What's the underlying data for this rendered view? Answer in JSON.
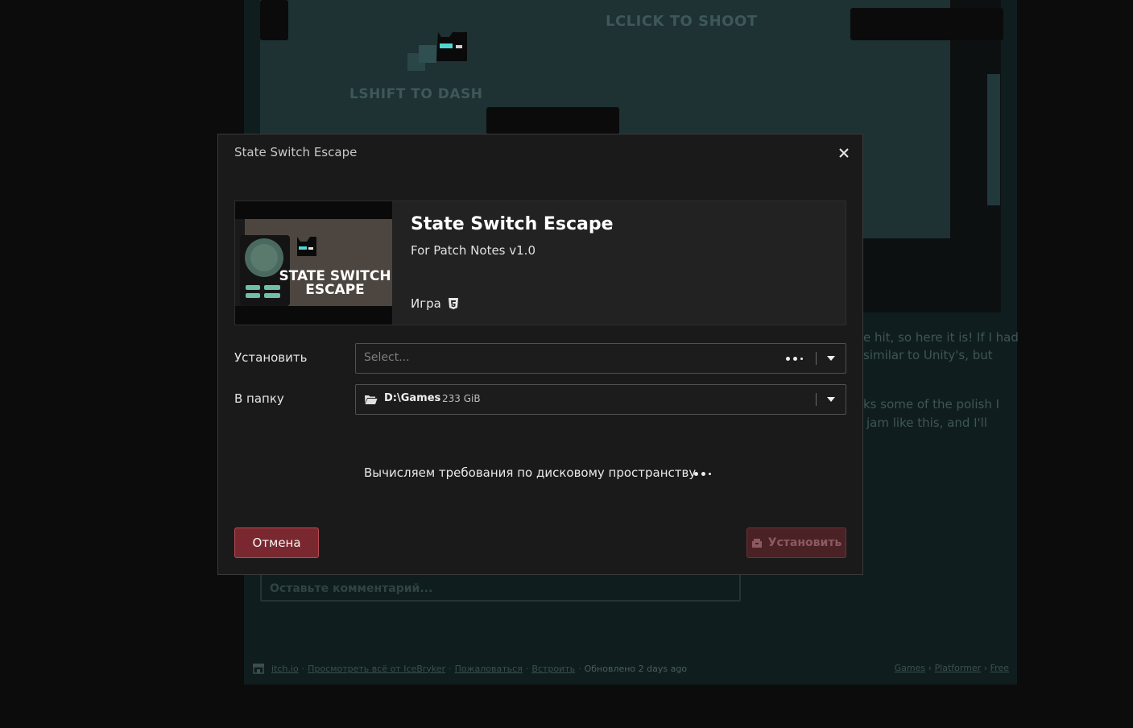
{
  "background": {
    "game_hints": {
      "shoot": "LCLICK TO SHOOT",
      "dash": "LSHIFT TO DASH"
    },
    "description_lines": [
      "e hit, so here it is! If I had",
      "similar to Unity's, but",
      "ks some of the polish I",
      "jam like this, and I'll"
    ],
    "comment_placeholder": "Оставьте комментарий...",
    "footer": {
      "links_left": [
        "itch.io",
        "Просмотреть всё от IceBryker",
        "Пожаловаться",
        "Встроить"
      ],
      "updated": "Обновлено 2 days ago",
      "breadcrumbs": [
        "Games",
        "Platformer",
        "Free"
      ]
    }
  },
  "modal": {
    "title": "State Switch Escape",
    "close_icon": "close-icon",
    "game": {
      "name": "State Switch Escape",
      "subtitle": "For Patch Notes v1.0",
      "type_label": "Игра",
      "type_icon": "html5-icon",
      "thumbnail_text_line1": "STATE SWITCH",
      "thumbnail_text_line2": "ESCAPE"
    },
    "install_row": {
      "label": "Установить",
      "placeholder": "Select..."
    },
    "folder_row": {
      "label": "В папку",
      "path": "D:\\Games",
      "free_space": "233 GiB"
    },
    "status_text": "Вычисляем требования по дисковому пространству",
    "cancel_label": "Отмена",
    "install_label": "Установить"
  },
  "colors": {
    "accent_red": "#7a2830",
    "accent_red_border": "#b94a53",
    "disabled_red": "#4a2226",
    "modal_bg": "#1a1a1a"
  }
}
